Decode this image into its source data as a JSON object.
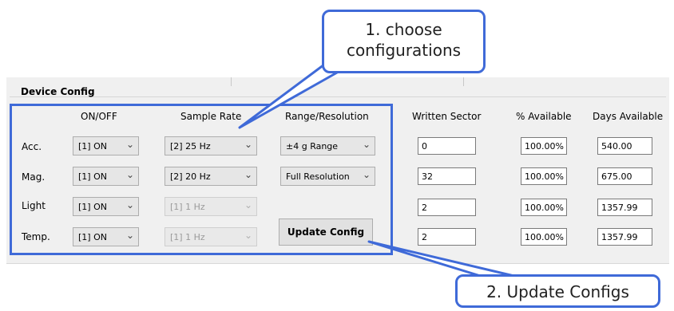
{
  "callouts": {
    "choose_line1": "1. choose",
    "choose_line2": "configurations",
    "update": "2. Update Configs"
  },
  "group_title": "Device Config",
  "columns": {
    "on_off": "ON/OFF",
    "sample_rate": "Sample Rate",
    "range_resolution": "Range/Resolution",
    "written_sector": "Written Sector",
    "pct_available": "% Available",
    "days_available": "Days Available"
  },
  "rows": [
    {
      "label": "Acc.",
      "on_off": "[1] ON",
      "sample_rate": "[2] 25 Hz",
      "sample_rate_enabled": true,
      "range": "±4 g Range",
      "written_sector": "0",
      "pct_available": "100.00%",
      "days_available": "540.00"
    },
    {
      "label": "Mag.",
      "on_off": "[1] ON",
      "sample_rate": "[2] 20 Hz",
      "sample_rate_enabled": true,
      "range": "Full Resolution",
      "written_sector": "32",
      "pct_available": "100.00%",
      "days_available": "675.00"
    },
    {
      "label": "Light",
      "on_off": "[1] ON",
      "sample_rate": "[1] 1 Hz",
      "sample_rate_enabled": false,
      "range": "",
      "written_sector": "2",
      "pct_available": "100.00%",
      "days_available": "1357.99"
    },
    {
      "label": "Temp.",
      "on_off": "[1] ON",
      "sample_rate": "[1] 1 Hz",
      "sample_rate_enabled": false,
      "range": "",
      "written_sector": "2",
      "pct_available": "100.00%",
      "days_available": "1357.99"
    }
  ],
  "update_button": "Update Config",
  "colors": {
    "annotation": "#3f6ad8",
    "panel": "#f0f0f0"
  },
  "icons": {
    "dropdown": "chevron-down-icon"
  }
}
